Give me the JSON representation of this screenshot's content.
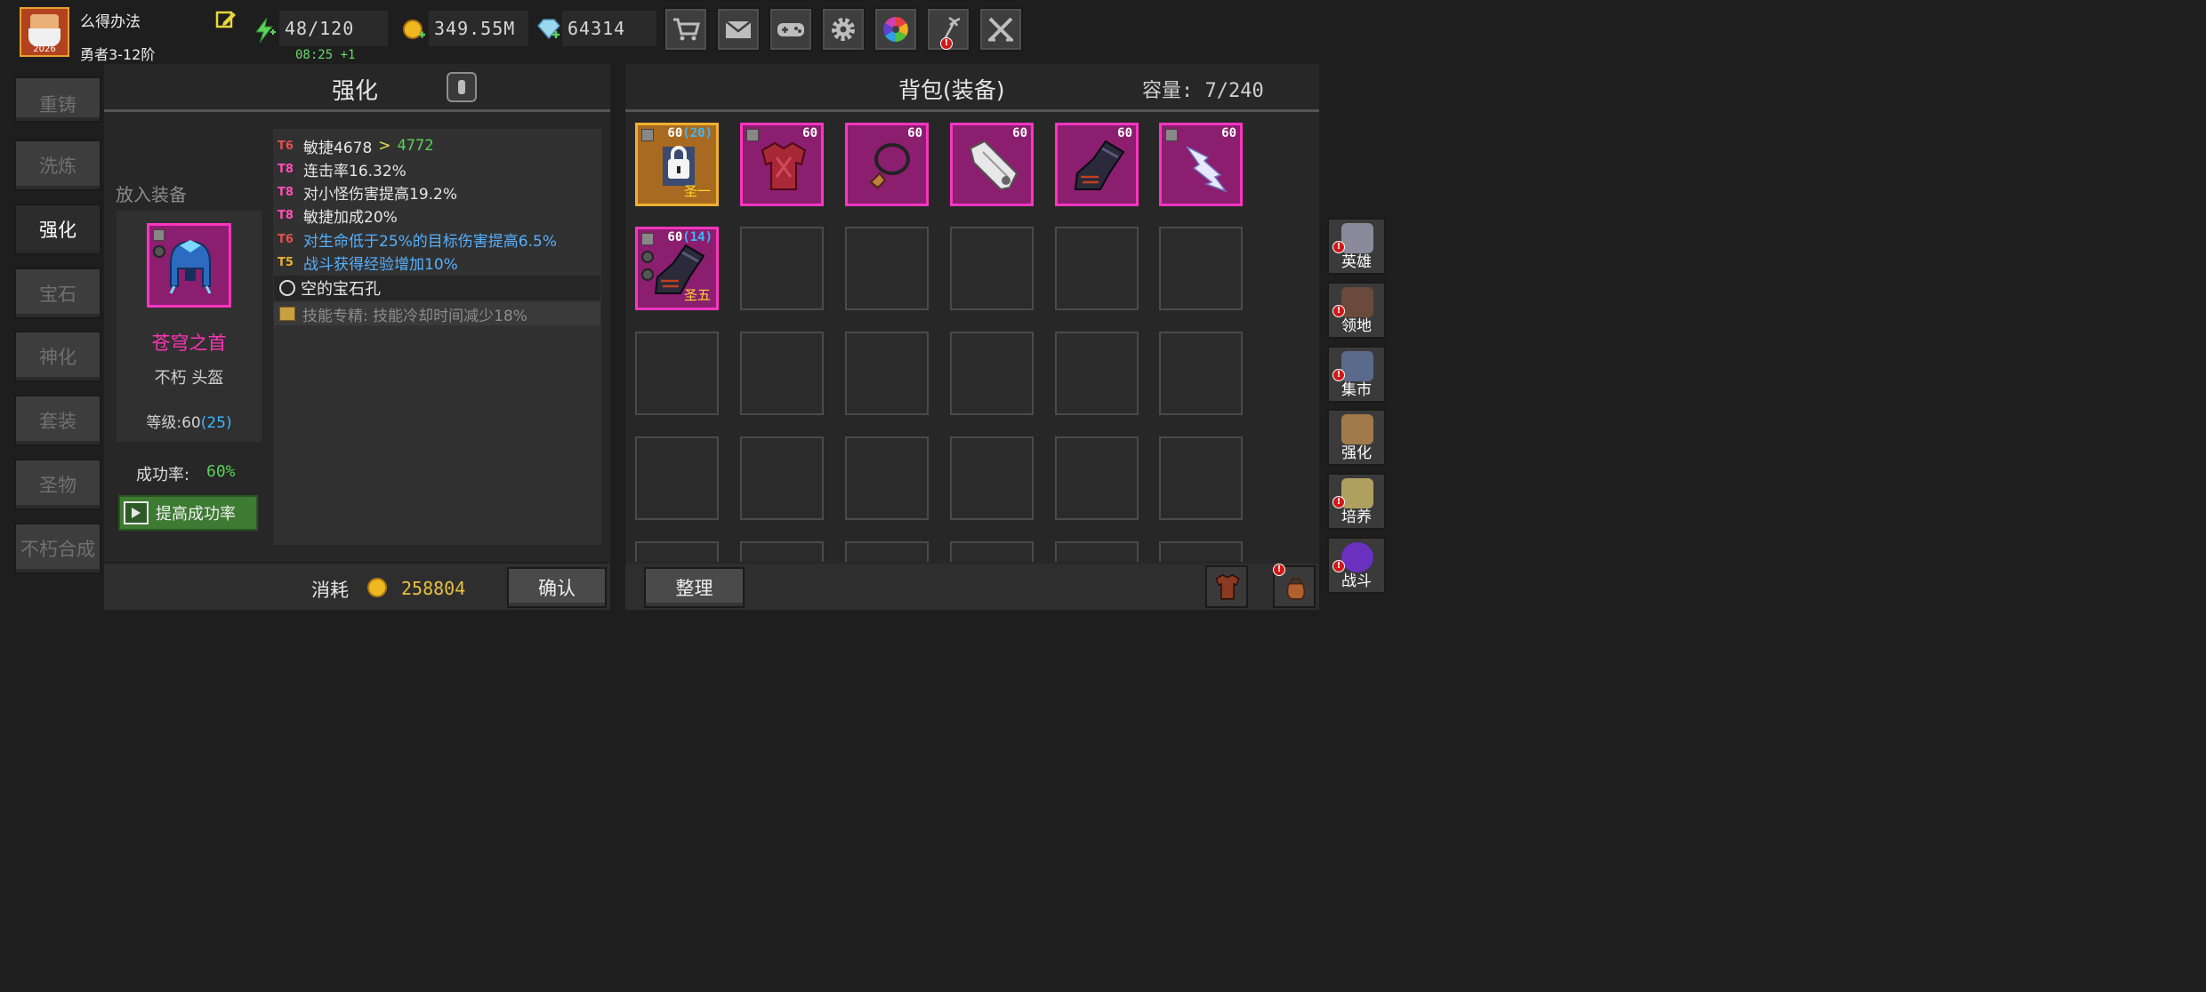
{
  "player": {
    "name": "么得办法",
    "rank": "勇者3-12阶",
    "avatar_year": "2026"
  },
  "resources": {
    "energy": "48/120",
    "energy_timer": "08:25 +1",
    "gold": "349.55M",
    "gems": "64314"
  },
  "top_buttons": [
    "cart-icon",
    "mail-icon",
    "gamepad-icon",
    "gear-icon",
    "color-wheel-icon",
    "fireworks-icon",
    "crossed-swords-icon"
  ],
  "left_nav": {
    "items": [
      "重铸",
      "洗炼",
      "强化",
      "宝石",
      "神化",
      "套装",
      "圣物",
      "不朽合成"
    ],
    "active": "强化"
  },
  "enhance": {
    "title": "强化",
    "place_label": "放入装备",
    "equip_name": "苍穹之首",
    "equip_type": "不朽  头盔",
    "level_label": "等级:60",
    "level_bonus": "(25)",
    "success_label": "成功率:",
    "success_value": "60%",
    "boost_label": "提高成功率",
    "stats": [
      {
        "tier": "T6",
        "text": "敏捷4678",
        "arrow": ">",
        "new": "4772"
      },
      {
        "tier": "T8",
        "text": "连击率16.32%"
      },
      {
        "tier": "T8",
        "text": "对小怪伤害提高19.2%"
      },
      {
        "tier": "T8",
        "text": "敏捷加成20%"
      },
      {
        "tier": "T6",
        "text": "对生命低于25%的目标伤害提高6.5%"
      },
      {
        "tier": "T5",
        "text": "战斗获得经验增加10%"
      }
    ],
    "gem_slot": "空的宝石孔",
    "skill_text": "技能专精:  技能冷却时间减少18%",
    "cost_label": "消耗",
    "cost_value": "258804",
    "confirm_label": "确认"
  },
  "bag": {
    "title": "背包(装备)",
    "capacity": "容量: 7/240",
    "sort_label": "整理",
    "items": [
      {
        "level": "60",
        "extra": "(20)",
        "holy": "圣一",
        "style": "gold",
        "icon": "locked-armor-icon"
      },
      {
        "level": "60",
        "extra": "",
        "holy": "",
        "style": "filled",
        "icon": "chest-armor-icon"
      },
      {
        "level": "60",
        "extra": "",
        "holy": "",
        "style": "filled",
        "icon": "necklace-icon"
      },
      {
        "level": "60",
        "extra": "",
        "holy": "",
        "style": "filled",
        "icon": "gauntlet-icon"
      },
      {
        "level": "60",
        "extra": "",
        "holy": "",
        "style": "filled",
        "icon": "dark-gauntlet-icon"
      },
      {
        "level": "60",
        "extra": "",
        "holy": "",
        "style": "filled",
        "icon": "lightning-sword-icon"
      },
      {
        "level": "60",
        "extra": "(14)",
        "holy": "圣五",
        "style": "filled",
        "icon": "dark-gauntlet-icon"
      }
    ]
  },
  "right_nav": [
    "英雄",
    "领地",
    "集市",
    "强化",
    "培养",
    "战斗"
  ]
}
